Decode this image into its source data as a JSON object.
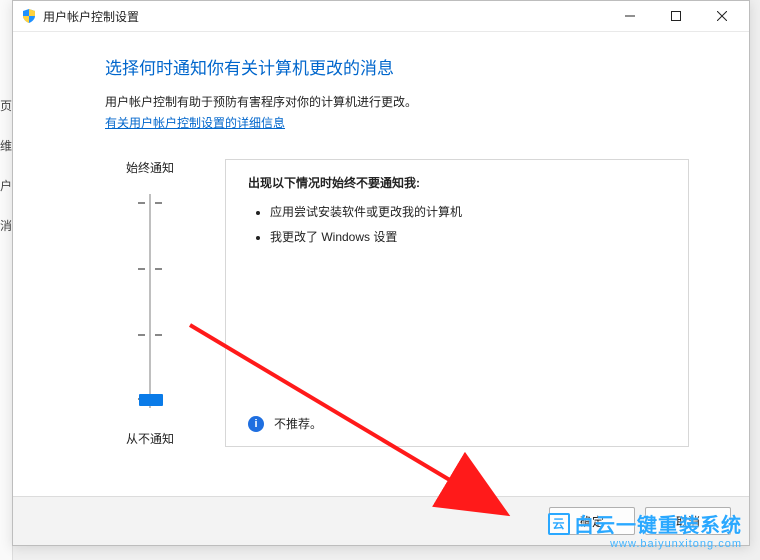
{
  "obscured_fragments": [
    "页",
    "维",
    "户",
    "消"
  ],
  "titlebar": {
    "title": "用户帐户控制设置"
  },
  "heading": "选择何时通知你有关计算机更改的消息",
  "description": "用户帐户控制有助于预防有害程序对你的计算机进行更改。",
  "link_text": "有关用户帐户控制设置的详细信息",
  "slider": {
    "top_label": "始终通知",
    "bottom_label": "从不通知"
  },
  "panel": {
    "heading": "出现以下情况时始终不要通知我:",
    "items": [
      "应用尝试安装软件或更改我的计算机",
      "我更改了 Windows 设置"
    ],
    "footer_text": "不推荐。"
  },
  "buttons": {
    "ok": "确定",
    "cancel": "取消"
  },
  "watermark": {
    "main": "白云一键重装系统",
    "sub": "www.baiyunxitong.com"
  }
}
